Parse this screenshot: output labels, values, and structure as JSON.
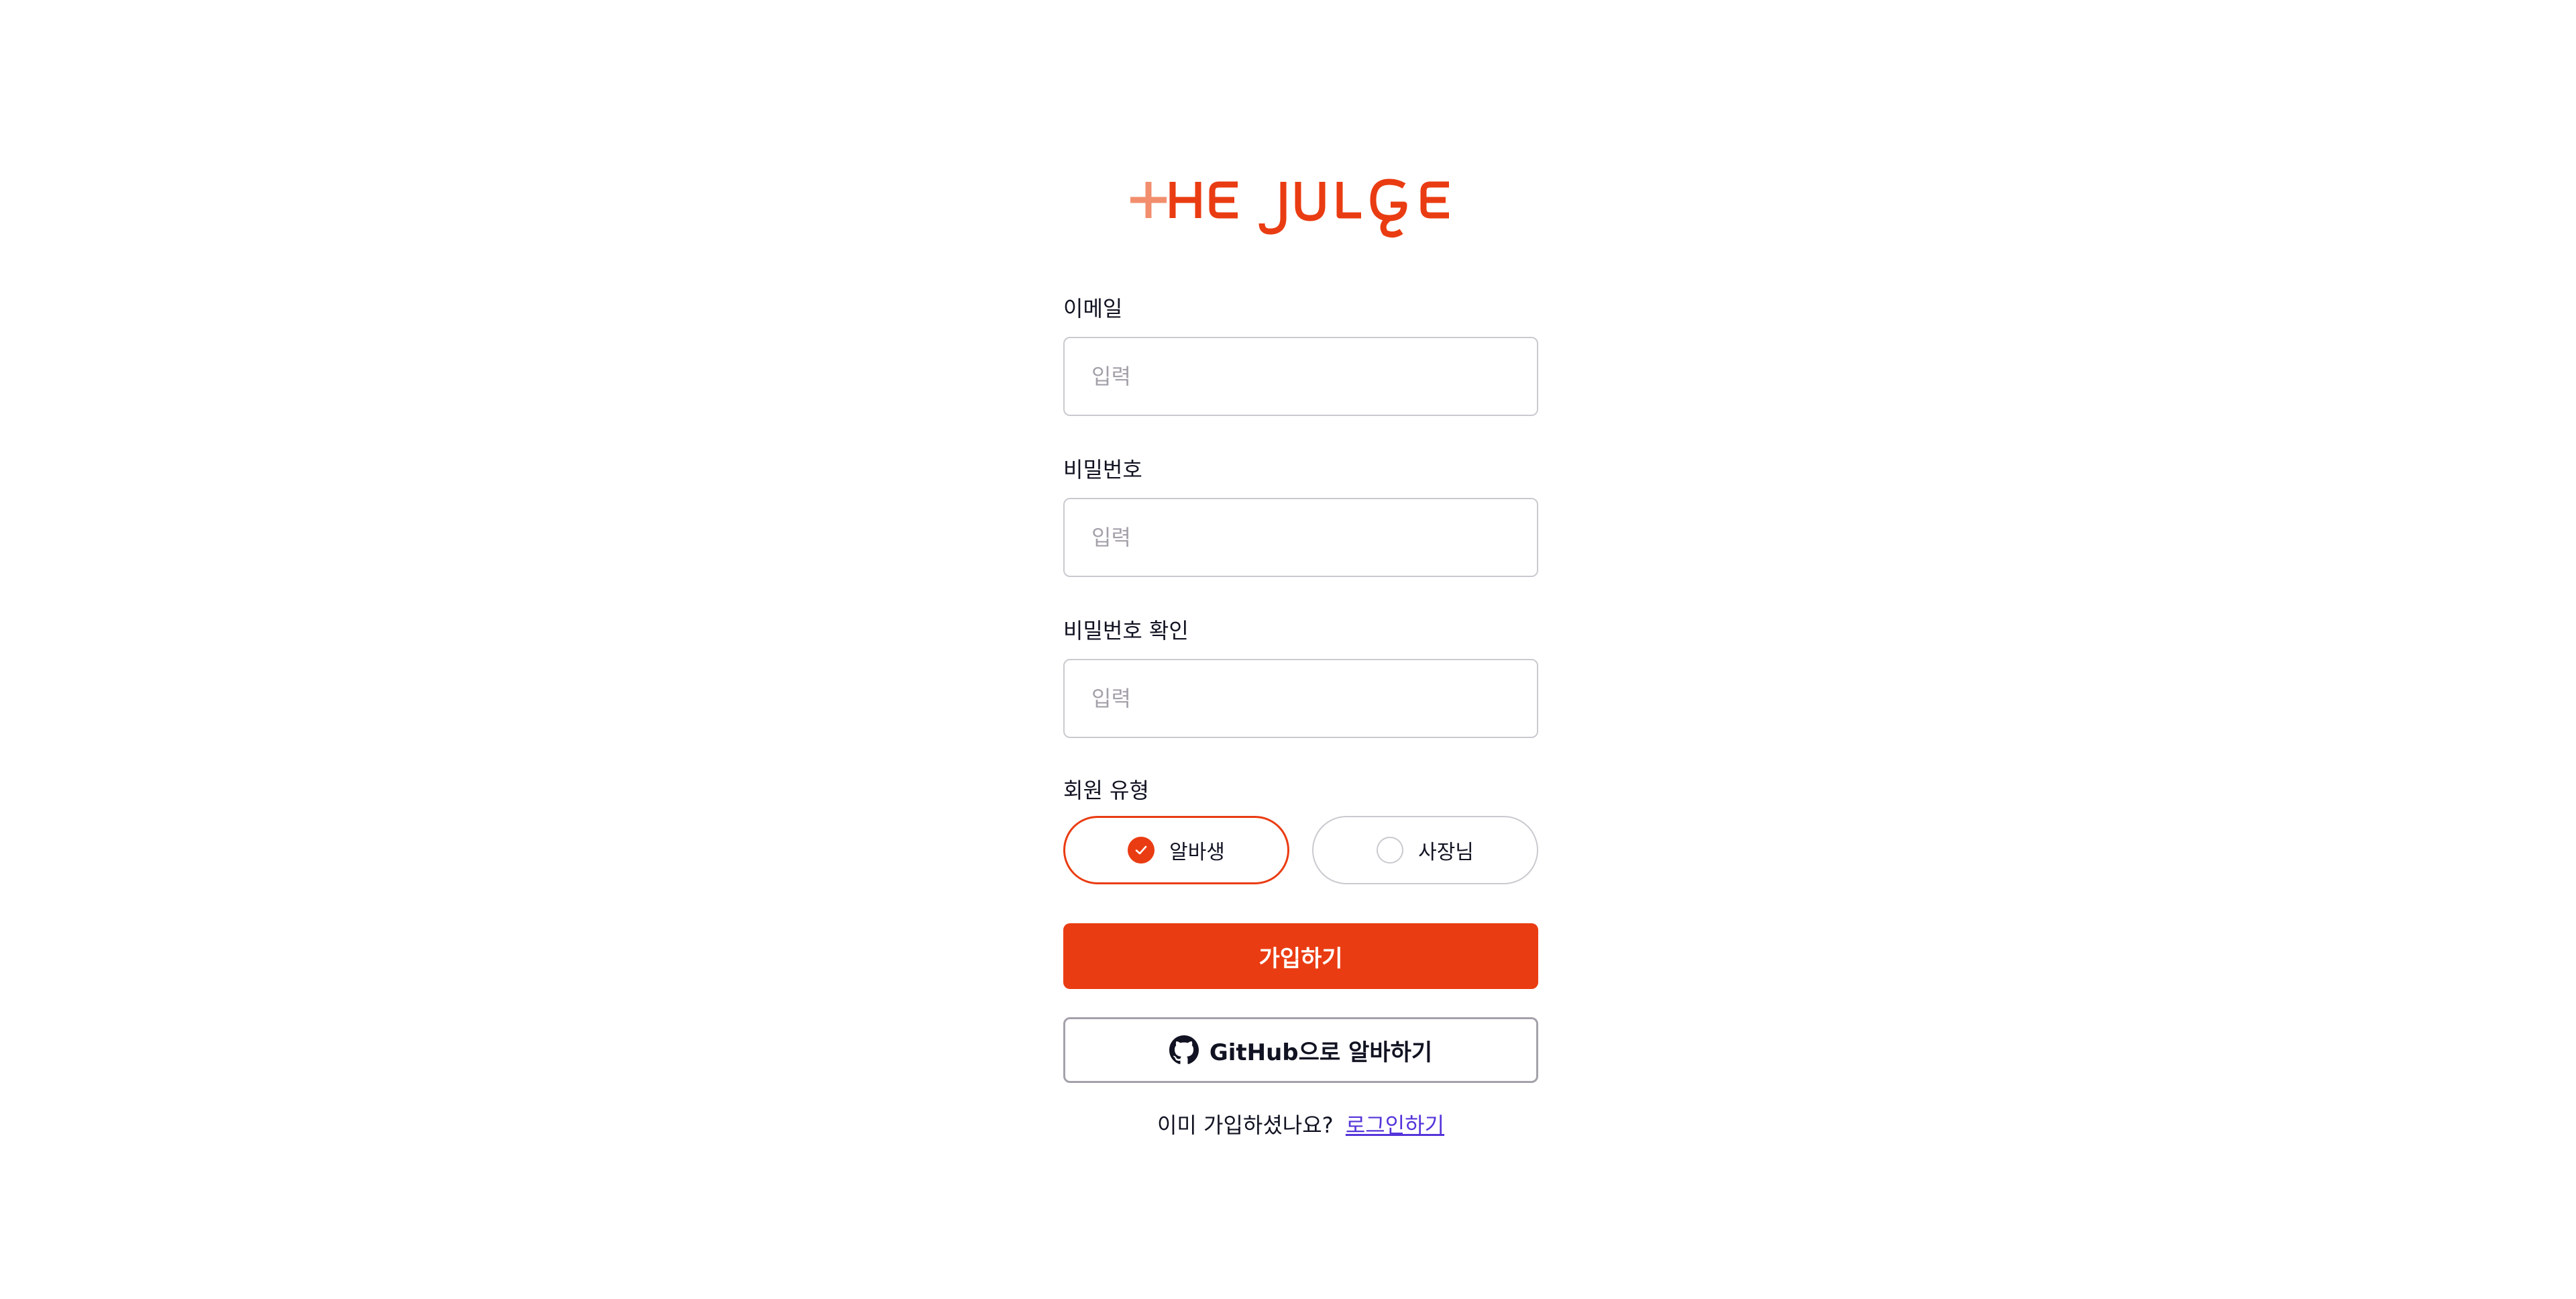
{
  "logo": {
    "text": "THE JULGE",
    "colors": {
      "plus": "#f28e6e",
      "main": "#ea3c12"
    }
  },
  "form": {
    "email": {
      "label": "이메일",
      "placeholder": "입력",
      "value": ""
    },
    "password": {
      "label": "비밀번호",
      "placeholder": "입력",
      "value": ""
    },
    "password_confirm": {
      "label": "비밀번호 확인",
      "placeholder": "입력",
      "value": ""
    },
    "member_type": {
      "label": "회원 유형",
      "options": [
        {
          "label": "알바생",
          "selected": true
        },
        {
          "label": "사장님",
          "selected": false
        }
      ]
    },
    "submit_label": "가입하기",
    "github_label": "GitHub으로 알바하기",
    "footer": {
      "text": "이미 가입하셨나요?",
      "link_label": "로그인하기"
    }
  },
  "colors": {
    "accent": "#ea3c12",
    "link": "#5534da",
    "border": "#cbc9cf",
    "placeholder": "#a4a1aa"
  },
  "icons": {
    "github": "github-icon",
    "check": "check-icon"
  }
}
